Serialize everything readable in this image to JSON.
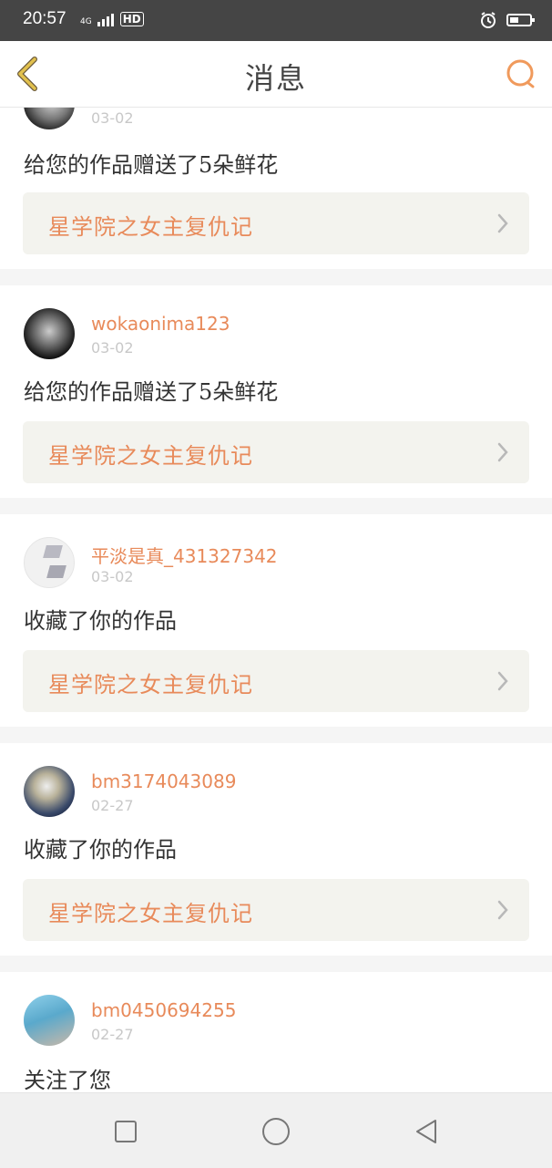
{
  "status_bar": {
    "time": "20:57",
    "network": "4G",
    "hd": "HD"
  },
  "header": {
    "title": "消息"
  },
  "messages": [
    {
      "username": "",
      "date": "03-02",
      "action": "给您的作品赠送了5朵鲜花",
      "work_title": "星学院之女主复仇记"
    },
    {
      "username": "wokaonima123",
      "date": "03-02",
      "action": "给您的作品赠送了5朵鲜花",
      "work_title": "星学院之女主复仇记"
    },
    {
      "username": "平淡是真_431327342",
      "date": "03-02",
      "action": "收藏了你的作品",
      "work_title": "星学院之女主复仇记"
    },
    {
      "username": "bm3174043089",
      "date": "02-27",
      "action": "收藏了你的作品",
      "work_title": "星学院之女主复仇记"
    },
    {
      "username": "bm0450694255",
      "date": "02-27",
      "action": "关注了您"
    }
  ],
  "colors": {
    "accent": "#e88a5a",
    "back_icon": "#d4a64a",
    "card_bg": "#f3f3ee"
  },
  "icons": {
    "back": "chevron-left-icon",
    "search": "search-icon",
    "card_arrow": "chevron-right-icon"
  }
}
